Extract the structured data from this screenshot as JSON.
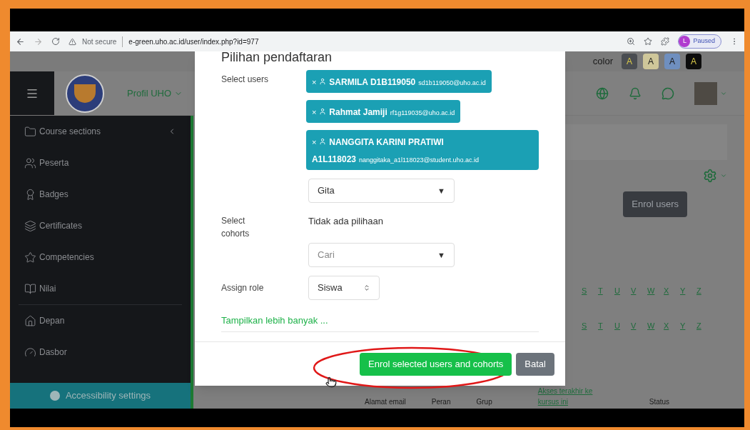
{
  "browser": {
    "warning": "Not secure",
    "url": "e-green.uho.ac.id/user/index.php?id=977",
    "profile_initial": "L",
    "profile_status": "Paused"
  },
  "header": {
    "color_label": "color",
    "color_buttons": [
      {
        "label": "A",
        "color": "#4a4d52"
      },
      {
        "label": "A",
        "color": "#cfc79a"
      },
      {
        "label": "A",
        "color": "#6f8fbf"
      },
      {
        "label": "A",
        "color": "#0d0d0d"
      }
    ],
    "site_menu": "Profil UHO"
  },
  "sidebar": {
    "items": [
      {
        "kind": "folder",
        "label": "Course sections"
      },
      {
        "kind": "users",
        "label": "Peserta"
      },
      {
        "kind": "badge",
        "label": "Badges"
      },
      {
        "kind": "layers",
        "label": "Certificates"
      },
      {
        "kind": "star",
        "label": "Competencies"
      },
      {
        "kind": "book",
        "label": "Nilai"
      }
    ],
    "bottom_items": [
      {
        "kind": "home",
        "label": "Depan"
      },
      {
        "kind": "gauge",
        "label": "Dasbor"
      }
    ],
    "accessibility": "Accessibility settings"
  },
  "main": {
    "enrol_button": "Enrol users",
    "letter_rows": [
      [
        "S",
        "T",
        "U",
        "V",
        "W",
        "X",
        "Y",
        "Z"
      ],
      [
        "S",
        "T",
        "U",
        "V",
        "W",
        "X",
        "Y",
        "Z"
      ]
    ],
    "columns": [
      "Alamat email",
      "Peran",
      "Grup",
      "Akses terakhir ke kursus ini",
      "Status"
    ]
  },
  "modal": {
    "title": "Pilihan pendaftaran",
    "select_users_label": "Select users",
    "remove_mark": "×",
    "chips": [
      {
        "name": "SARMILA D1B119050",
        "email": "sd1b119050@uho.ac.id"
      },
      {
        "name": "Rahmat Jamiji",
        "email": "rf1g119035@uho.ac.id"
      },
      {
        "name": "NANGGITA KARINI PRATIWI A1L118023",
        "email": "nanggitaka_a1l118023@student.uho.ac.id"
      }
    ],
    "user_search": {
      "value": "Gita",
      "arrow": "▼"
    },
    "cohorts_label": "Select cohorts",
    "cohorts_empty": "Tidak ada pilihaan",
    "cohort_search": {
      "placeholder": "Cari",
      "arrow": "▼"
    },
    "role_label": "Assign role",
    "role_value": "Siswa",
    "more_link": "Tampilkan lebih banyak ...",
    "submit": "Enrol selected users and cohorts",
    "cancel": "Batal"
  }
}
